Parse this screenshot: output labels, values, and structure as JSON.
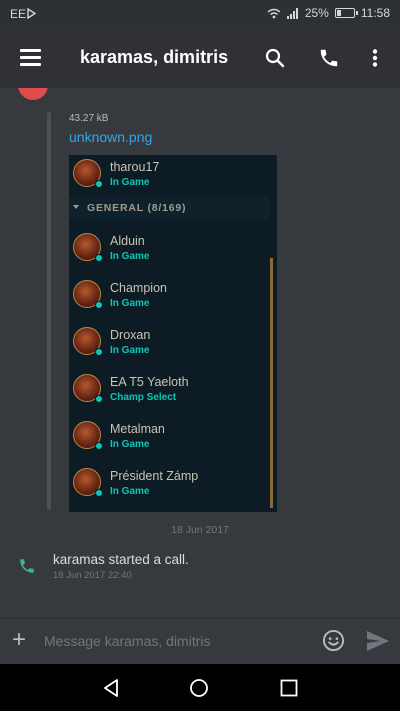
{
  "status_bar": {
    "carrier": "EE",
    "battery_percent": "25%",
    "battery_level": 0.25,
    "time": "11:58"
  },
  "header": {
    "title": "karamas, dimitris",
    "icons": [
      "menu-icon",
      "search-icon",
      "phone-icon",
      "more-vert-icon"
    ]
  },
  "attachment": {
    "file_size": "43.27 kB",
    "file_name": "unknown.png",
    "image": {
      "top_member": {
        "name": "tharou17",
        "status": "In Game"
      },
      "group_label": "GENERAL (8/169)",
      "members": [
        {
          "name": "Alduin",
          "status": "In Game"
        },
        {
          "name": "Champion",
          "status": "In Game"
        },
        {
          "name": "Droxan",
          "status": "In Game"
        },
        {
          "name": "EA T5 Yaeloth",
          "status": "Champ Select"
        },
        {
          "name": "Metalman",
          "status": "In Game"
        },
        {
          "name": "Président Zámp",
          "status": "In Game"
        }
      ]
    }
  },
  "date_separator": "18 Jun 2017",
  "system_message": {
    "text": "karamas started a call.",
    "timestamp": "18 Jun 2017 22:40"
  },
  "composer": {
    "placeholder": "Message karamas, dimitris"
  },
  "colors": {
    "background": "#36393e",
    "app_bar": "#2f3136",
    "link": "#2fa8ea",
    "call_green": "#43b581",
    "in_game_teal": "#0ac8b9"
  }
}
